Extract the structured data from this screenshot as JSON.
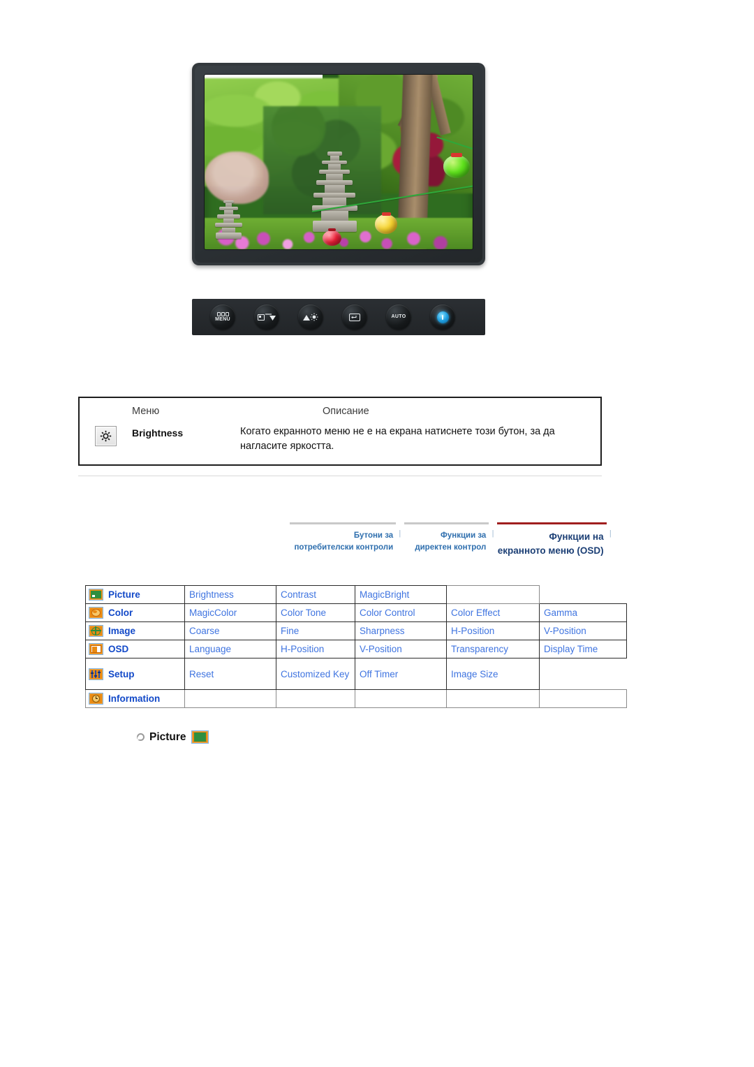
{
  "monitor": {
    "photo_alt": "Garden photograph with stone pagodas, green foliage, flowering azaleas and colored paper lanterns",
    "buttons": [
      {
        "name": "menu-button",
        "label": "MENU"
      },
      {
        "name": "source-down-button",
        "label": ""
      },
      {
        "name": "brightness-button",
        "label": ""
      },
      {
        "name": "enter-button",
        "label": ""
      },
      {
        "name": "auto-button",
        "label": "AUTO"
      },
      {
        "name": "power-button",
        "label": ""
      }
    ]
  },
  "description_table": {
    "header": {
      "menu": "Меню",
      "description": "Описание"
    },
    "rows": [
      {
        "icon": "brightness-icon",
        "menu": "Brightness",
        "description": "Когато екранното меню не е на екрана натиснете този бутон, за да нагласите яркостта."
      }
    ]
  },
  "tabs": [
    {
      "name": "tab-user-control-buttons",
      "line1": "Бутони за",
      "line2": "потребителски контроли",
      "active": false
    },
    {
      "name": "tab-direct-control-functions",
      "line1": "Функции за",
      "line2": "директен контрол",
      "active": false
    },
    {
      "name": "tab-osd-menu-functions",
      "line1": "Функции на",
      "line2": "екранното меню (OSD)",
      "active": true
    }
  ],
  "osd_menu": {
    "rows": [
      {
        "icon": "picture-icon",
        "category": "Picture",
        "items": [
          "Brightness",
          "Contrast",
          "MagicBright"
        ]
      },
      {
        "icon": "color-icon",
        "category": "Color",
        "items": [
          "MagicColor",
          "Color Tone",
          "Color Control",
          "Color Effect",
          "Gamma"
        ]
      },
      {
        "icon": "image-icon",
        "category": "Image",
        "items": [
          "Coarse",
          "Fine",
          "Sharpness",
          "H-Position",
          "V-Position"
        ]
      },
      {
        "icon": "osd-icon",
        "category": "OSD",
        "items": [
          "Language",
          "H-Position",
          "V-Position",
          "Transparency",
          "Display Time"
        ]
      },
      {
        "icon": "setup-icon",
        "category": "Setup",
        "items": [
          "Reset",
          "Customized Key",
          "Off Timer",
          "Image Size"
        ]
      },
      {
        "icon": "information-icon",
        "category": "Information",
        "items": []
      }
    ]
  },
  "section_heading": {
    "label": "Picture",
    "icon": "picture-icon"
  },
  "colors": {
    "menu_link": "#3f74e0",
    "menu_category": "#1249c8",
    "tab_inactive": "#2f6fae",
    "tab_active": "#1c3f75",
    "tab_active_border": "#a01f1f",
    "icon_orange": "#e98a13",
    "icon_border_blue": "#7fb4e8",
    "bezel": "#33383c"
  }
}
